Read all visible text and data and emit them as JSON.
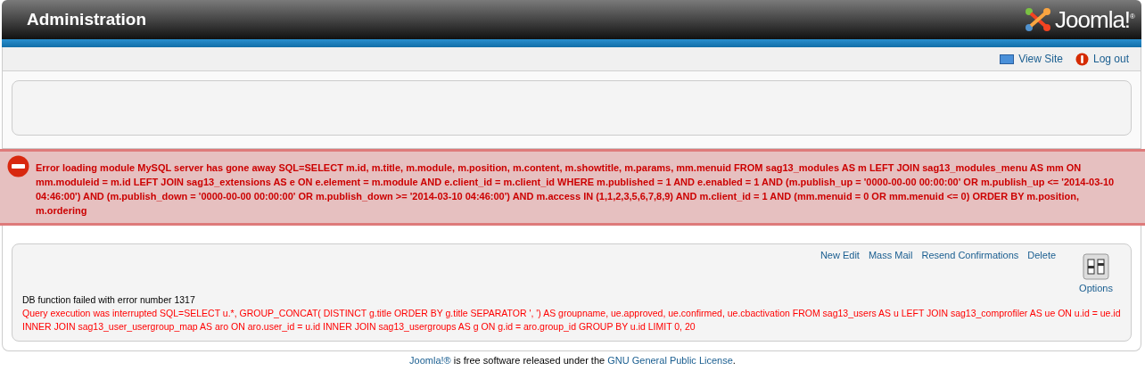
{
  "header": {
    "title": "Administration",
    "logo_text": "Joomla!",
    "logo_mark": "®"
  },
  "top_links": [
    {
      "kind": "view",
      "label": "View Site"
    },
    {
      "kind": "logout",
      "label": "Log out"
    }
  ],
  "error_message": "Error loading module MySQL server has gone away SQL=SELECT m.id, m.title, m.module, m.position, m.content, m.showtitle, m.params, mm.menuid FROM sag13_modules AS m LEFT JOIN sag13_modules_menu AS mm ON mm.moduleid = m.id LEFT JOIN sag13_extensions AS e ON e.element = m.module AND e.client_id = m.client_id WHERE m.published = 1 AND e.enabled = 1 AND (m.publish_up = '0000-00-00 00:00:00' OR m.publish_up <= '2014-03-10 04:46:00') AND (m.publish_down = '0000-00-00 00:00:00' OR m.publish_down >= '2014-03-10 04:46:00') AND m.access IN (1,1,2,3,5,6,7,8,9) AND m.client_id = 1 AND (mm.menuid = 0 OR mm.menuid <= 0) ORDER BY m.position, m.ordering",
  "toolbar": [
    "New Edit",
    "Mass Mail",
    "Resend Confirmations",
    "Delete"
  ],
  "options_button": "Options",
  "db_error": {
    "title": "DB function failed with error number 1317",
    "query": "Query execution was interrupted SQL=SELECT u.*, GROUP_CONCAT( DISTINCT g.title ORDER BY g.title SEPARATOR ', ') AS groupname, ue.approved, ue.confirmed, ue.cbactivation FROM sag13_users AS u LEFT JOIN sag13_comprofiler AS ue ON u.id = ue.id INNER JOIN sag13_user_usergroup_map AS aro ON aro.user_id = u.id INNER JOIN sag13_usergroups AS g ON g.id = aro.group_id GROUP BY u.id LIMIT 0, 20"
  },
  "footer": {
    "link": "Joomla!®",
    "text": "is free software released under the",
    "license_link": "GNU General Public License",
    "end": "."
  }
}
